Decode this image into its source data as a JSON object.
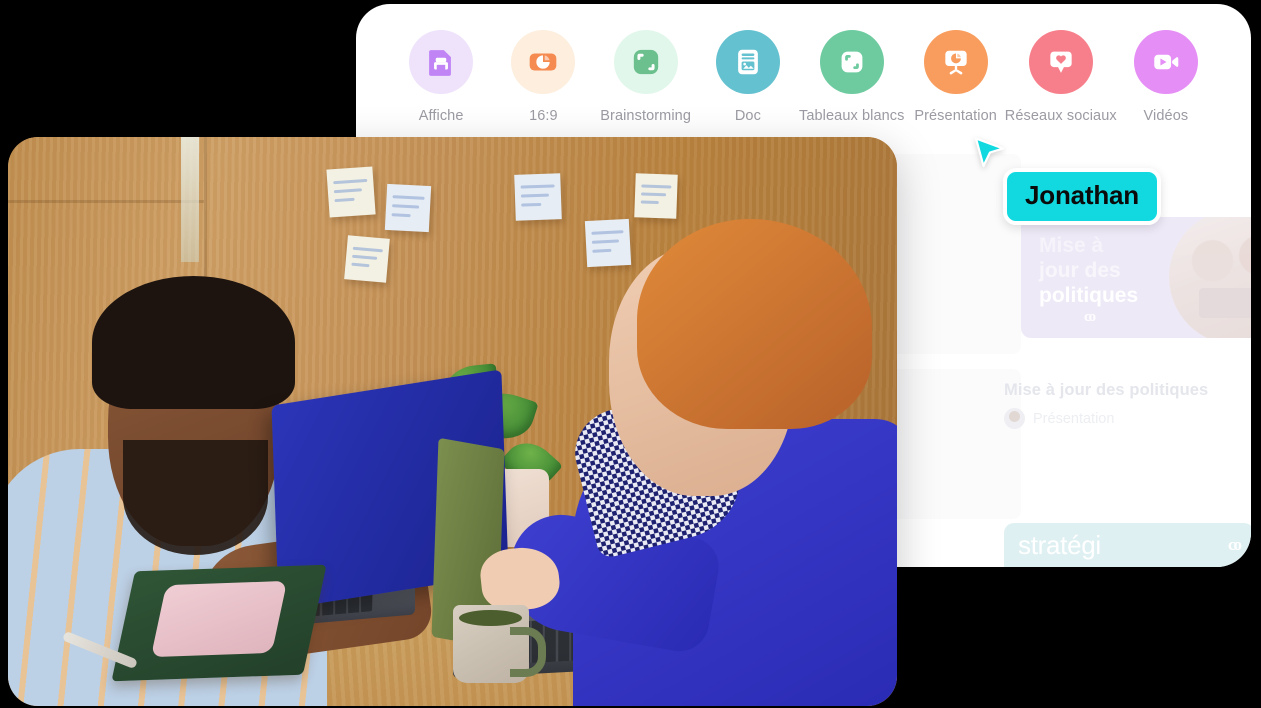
{
  "app": {
    "panel_name": "design-tool-window"
  },
  "template_strip": {
    "items": [
      {
        "label": "Affiche",
        "icon": "poster-icon",
        "circle_bg": "#efe3fb",
        "tile": "#c084f5"
      },
      {
        "label": "16:9",
        "icon": "slide-chart-icon",
        "circle_bg": "#fdeedd",
        "tile": "#f58b50"
      },
      {
        "label": "Brainstorming",
        "icon": "expand-frame-icon",
        "circle_bg": "#e2f7eb",
        "tile": "#6cc08e"
      },
      {
        "label": "Doc",
        "icon": "document-image-icon",
        "circle_bg": "#64c1cf",
        "tile": "#ffffff"
      },
      {
        "label": "Tableaux blancs",
        "icon": "whiteboard-icon",
        "circle_bg": "#6ecba0",
        "tile": "#ffffff"
      },
      {
        "label": "Présentation",
        "icon": "presentation-icon",
        "circle_bg": "#f89d5d",
        "tile": "#ffffff"
      },
      {
        "label": "Réseaux sociaux",
        "icon": "social-heart-icon",
        "circle_bg": "#f77f8b",
        "tile": "#ffffff"
      },
      {
        "label": "Vidéos",
        "icon": "video-camera-icon",
        "circle_bg": "#e58ef5",
        "tile": "#ffffff"
      }
    ]
  },
  "cursor": {
    "name": "Jonathan",
    "tag_color": "#12d9e0",
    "pointer_color": "#12d9e0"
  },
  "design_card": {
    "thumbnail": {
      "line1": "Mise à",
      "line2": "jour des",
      "line3": "politiques",
      "brand_mark": "со",
      "bg_color": "#eee9f7"
    },
    "title": "Mise à jour des politiques",
    "type": "Présentation"
  },
  "banner": {
    "text": "stratégi",
    "brand_mark": "со",
    "bg_color": "#dff0f2"
  },
  "photo": {
    "alt_name": "two-colleagues-at-desk-with-laptops"
  }
}
